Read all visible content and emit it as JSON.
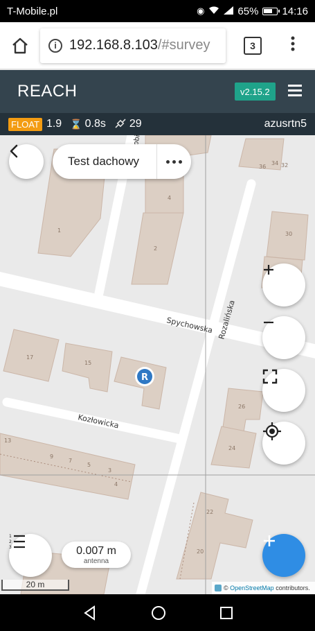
{
  "status_bar": {
    "carrier": "T-Mobile.pl",
    "battery": "65%",
    "time": "14:16",
    "icons": [
      "eye-icon",
      "wifi-icon",
      "signal-icon",
      "battery-icon"
    ]
  },
  "browser": {
    "url_host": "192.168.8.103",
    "url_hash": "/#survey",
    "tab_count": "3",
    "icons": [
      "home-icon",
      "info-icon",
      "menu-icon"
    ]
  },
  "app": {
    "title": "REACH",
    "version": "v2.15.2"
  },
  "status": {
    "solution": "FLOAT",
    "age": "1.9",
    "latency": "0.8s",
    "satellites": "29",
    "base_name": "azusrtn5"
  },
  "survey": {
    "name": "Test dachowy"
  },
  "map": {
    "streets": [
      "Spychowska",
      "Rozalińska",
      "Kozłowicka",
      "obi"
    ],
    "house_numbers": [
      "1",
      "2",
      "4",
      "36",
      "34",
      "32",
      "30",
      "17",
      "15",
      "26",
      "24",
      "13",
      "9",
      "7",
      "5",
      "3",
      "4",
      "22",
      "20"
    ],
    "marker_label": "R",
    "colors": {
      "background": "#eaeaea",
      "building": "#dccfc4",
      "building_stroke": "#cbb6a8",
      "road": "#ffffff",
      "marker": "#2f78c4"
    }
  },
  "controls": {
    "antenna_value": "0.007 m",
    "antenna_label": "antenna",
    "scale": "20 m",
    "attribution_prefix": "©",
    "attribution_link": "OpenStreetMap",
    "attribution_suffix": "contributors."
  },
  "colors": {
    "header": "#34444e",
    "strip": "#24313a",
    "version_badge": "#1fa38a",
    "float_badge": "#f39c12",
    "fab_accent": "#2f8de4"
  }
}
